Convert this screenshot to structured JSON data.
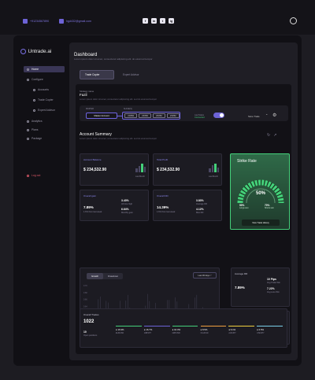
{
  "topbar": {
    "phone": "+91234567890",
    "email": "hgd432@gmail.com",
    "social": [
      "f",
      "in",
      "t",
      "ig"
    ]
  },
  "sidebar": {
    "brand": "Untrade.ai",
    "items": [
      {
        "label": "Home",
        "active": true
      },
      {
        "label": "Configure",
        "active": false
      },
      {
        "label": "Accounts",
        "active": false
      },
      {
        "label": "Trade Copier",
        "active": false
      },
      {
        "label": "Expert Advisor",
        "active": false
      },
      {
        "label": "Analytics",
        "active": false
      },
      {
        "label": "Plans",
        "active": false
      },
      {
        "label": "Package",
        "active": false
      }
    ],
    "logout": "Log out"
  },
  "header": {
    "title": "Dashboard",
    "subtitle": "Lorem ipsum dolor sit amet, consectetur adipiscing elit. do eiusmod tempor",
    "tabs": [
      "Trade Copier",
      "Expert Advisor"
    ]
  },
  "strategy": {
    "label": "Strategy name",
    "name": "Fazil",
    "desc": "Lorem ipsum dolor sit amet, consectetur adipiscing elit. sed do eiusmod tempor",
    "master_head": "MASTER",
    "slave_head": "SLAVE(S)",
    "master_btn": "Master Account",
    "slaves": [
      "23352",
      "23352",
      "23352",
      "23352"
    ],
    "status_label": "Last Status",
    "status_value": "Connected",
    "store_label": "Store Trade"
  },
  "account_summary": {
    "title": "Account Summary",
    "subtitle": "Lorem ipsum dolor sit amet, consectetur adipiscing elit. sed do eiusmod tempor",
    "balance": {
      "label": "Account Balance",
      "value": "$ 234,532.90",
      "note": "Last Month"
    },
    "profit": {
      "label": "Total Profit",
      "value": "$ 234,532.90",
      "note": "Last Month"
    },
    "gain": {
      "label": "Overall gain",
      "main": "7.89%",
      "main_note": "1.6% from last week",
      "a": "3.43%",
      "a_note": "All time high",
      "b": "6.64%",
      "b_note": "Monthly gain"
    },
    "dd": {
      "label": "Overall DD",
      "main": "14.39%",
      "main_note": "1.6% from last week",
      "a": "3.83%",
      "a_note": "Average DD",
      "b": "4.12%",
      "b_note": "Max DD"
    }
  },
  "strike_rate": {
    "title": "Strike Rate",
    "value": "50%",
    "long_win": "50%",
    "long_label": "Longs won",
    "short_win": "70%",
    "short_label": "Shorts won",
    "button": "View Trade History"
  },
  "growth": {
    "tabs": [
      "Growth",
      "Drawdown"
    ],
    "range": "Last 30 days",
    "legend": "Equity",
    "date_from": "May 26, 2023",
    "date_to": "Jun 24, 2023",
    "y_labels": [
      "0.70",
      "0.68",
      "0.66",
      "0.64",
      "0.62",
      "0.60",
      "0.58",
      "0.56"
    ]
  },
  "avg_rr": {
    "label": "Average RR",
    "value": "7.89%",
    "a": "10 Pips",
    "a_note": "Avg Trade Win",
    "b": "7.22%",
    "b_note": "Avg Loss Win"
  },
  "trade_type": {
    "label": "Trade type",
    "value": "Scalper",
    "time": "15 Min",
    "time_note": "Avg Trade Duration"
  },
  "overall_trades": {
    "label": "Overall Trades",
    "total": "1022",
    "open": "10",
    "open_note": "Open positions",
    "pairs": [
      {
        "pct": "16.9%",
        "sym": "EURUSD",
        "color": "#44d07a"
      },
      {
        "pct": "16.7%",
        "sym": "GBPJPY",
        "color": "#6d63d6"
      },
      {
        "pct": "10.3%",
        "sym": "GBPUSD",
        "color": "#44d07a"
      },
      {
        "pct": "8.5%",
        "sym": "XAUUSD",
        "color": "#f0a040"
      },
      {
        "pct": "6.1%",
        "sym": "AUDJPY",
        "color": "#f0d040"
      },
      {
        "pct": "6.5%",
        "sym": "USDJPY",
        "color": "#7ad0e8"
      }
    ]
  },
  "colors": {
    "accent": "#6d63d6",
    "positive": "#44d07a",
    "bg": "#1d1c22"
  }
}
